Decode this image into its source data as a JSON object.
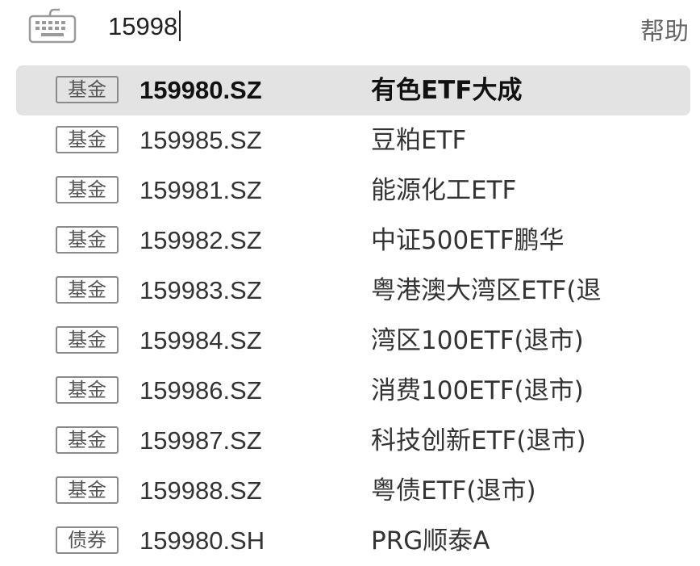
{
  "search": {
    "query": "15998",
    "help_label": "帮助"
  },
  "icons": {
    "keyboard": "keyboard-icon"
  },
  "colors": {
    "selected_row_bg": "#e3e3e3",
    "tag_border": "#8a8a8a"
  },
  "results": [
    {
      "type": "基金",
      "code": "159980.SZ",
      "name": "有色ETF大成",
      "selected": true
    },
    {
      "type": "基金",
      "code": "159985.SZ",
      "name": "豆粕ETF",
      "selected": false
    },
    {
      "type": "基金",
      "code": "159981.SZ",
      "name": "能源化工ETF",
      "selected": false
    },
    {
      "type": "基金",
      "code": "159982.SZ",
      "name": "中证500ETF鹏华",
      "selected": false
    },
    {
      "type": "基金",
      "code": "159983.SZ",
      "name": "粤港澳大湾区ETF(退",
      "selected": false
    },
    {
      "type": "基金",
      "code": "159984.SZ",
      "name": "湾区100ETF(退市)",
      "selected": false
    },
    {
      "type": "基金",
      "code": "159986.SZ",
      "name": "消费100ETF(退市)",
      "selected": false
    },
    {
      "type": "基金",
      "code": "159987.SZ",
      "name": "科技创新ETF(退市)",
      "selected": false
    },
    {
      "type": "基金",
      "code": "159988.SZ",
      "name": "粤债ETF(退市)",
      "selected": false
    },
    {
      "type": "债券",
      "code": "159980.SH",
      "name": "PRG顺泰A",
      "selected": false
    }
  ]
}
